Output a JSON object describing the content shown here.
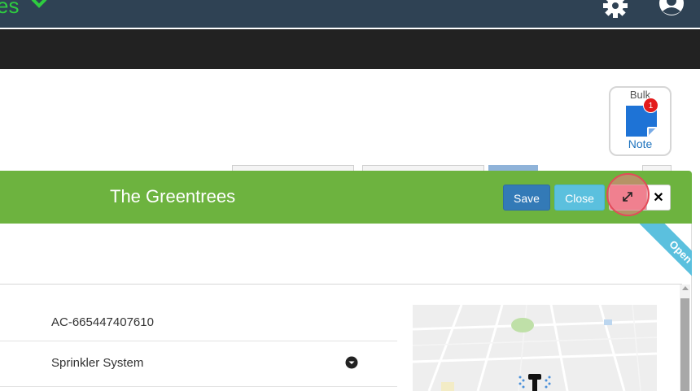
{
  "nav": {
    "title_fragment": "es",
    "icons": {
      "dropdown": "chevron-down-icon",
      "settings": "gear-icon",
      "account": "user-circle-icon"
    }
  },
  "bulk_note": {
    "top_label": "Bulk",
    "badge_count": "1",
    "bottom_label": "Note",
    "icon": "note-icon"
  },
  "modal": {
    "title": "The Greentrees",
    "save_label": "Save",
    "close_label": "Close",
    "expand_icon": "expand-icon",
    "x_label": "✕",
    "status_ribbon": "Open"
  },
  "fields": {
    "account_code": "AC-665447407610",
    "service_type": "Sprinkler System"
  },
  "colors": {
    "nav_bg": "#2f4254",
    "header_green": "#6db33f",
    "save_blue": "#337ab7",
    "close_cyan": "#5bc0de",
    "badge_red": "#e31b1b"
  }
}
